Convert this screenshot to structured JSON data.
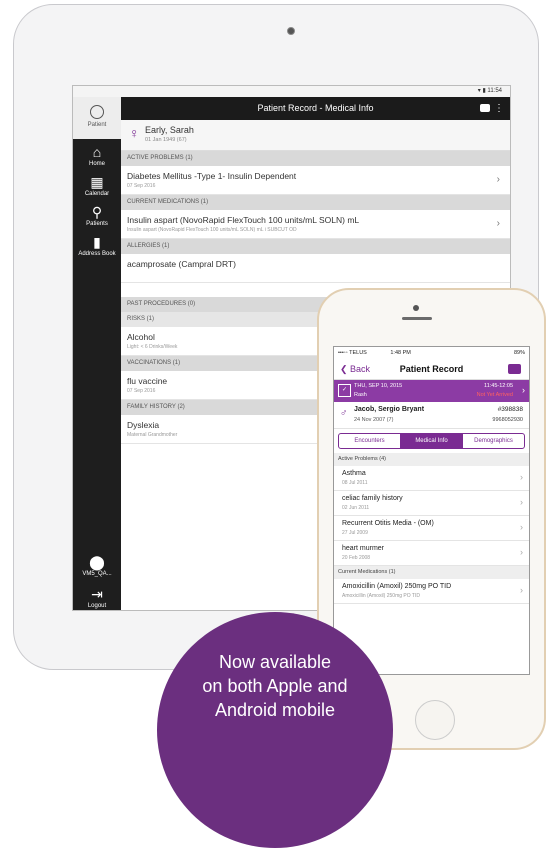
{
  "tablet": {
    "status_time": "11:54",
    "title": "Patient Record - Medical Info",
    "patient": {
      "name": "Early, Sarah",
      "dob": "01 Jan 1949 (67)"
    },
    "sidebar": [
      {
        "label": "Patient",
        "icon": "patient-icon"
      },
      {
        "label": "Home",
        "icon": "home-icon"
      },
      {
        "label": "Calendar",
        "icon": "calendar-icon"
      },
      {
        "label": "Patients",
        "icon": "search-icon"
      },
      {
        "label": "Address Book",
        "icon": "address-book-icon"
      },
      {
        "label": "VM5_QA...",
        "icon": "location-icon"
      },
      {
        "label": "Logout",
        "icon": "logout-icon"
      }
    ],
    "sections": [
      {
        "header": "ACTIVE PROBLEMS (1)",
        "title": "Diabetes Mellitus -Type 1- Insulin Dependent",
        "sub": "07 Sep 2016"
      },
      {
        "header": "CURRENT MEDICATIONS (1)",
        "title": "Insulin aspart (NovoRapid FlexTouch 100 units/mL SOLN) mL",
        "sub": "Insulin aspart (NovoRapid FlexTouch 100 units/mL SOLN) mL i SUBCUT OD"
      },
      {
        "header": "ALLERGIES (1)",
        "title": "acamprosate (Campral DRT)",
        "sub": ""
      },
      {
        "header": "PAST PROCEDURES (0)"
      },
      {
        "header": "RISKS (1)",
        "title": "Alcohol",
        "sub": "Light: < 6 Drinks/Week"
      },
      {
        "header": "VACCINATIONS (1)",
        "title": "flu vaccine",
        "sub": "07 Sep 2016"
      },
      {
        "header": "FAMILY HISTORY (2)",
        "title": "Dyslexia",
        "sub": "Maternal Grandmother"
      }
    ]
  },
  "phone": {
    "carrier": "•••◦◦ TELUS",
    "time": "1:48 PM",
    "battery": "89%",
    "back": "Back",
    "title": "Patient Record",
    "encounter": {
      "date": "THU, SEP 10, 2015",
      "reason": "Rash",
      "time": "11:45-12:05",
      "status": "Not Yet Arrived"
    },
    "patient": {
      "name": "Jacob, Sergio Bryant",
      "dob": "24 Nov 2007 (7)",
      "id": "#398838",
      "hc": "9968052930"
    },
    "tabs": [
      "Encounters",
      "Medical Info",
      "Demographics"
    ],
    "active_header": "Active Problems (4)",
    "problems": [
      {
        "title": "Asthma",
        "date": "08 Jul 2011"
      },
      {
        "title": "celiac family history",
        "date": "02 Jun 2011"
      },
      {
        "title": "Recurrent Otitis Media - (OM)",
        "date": "27 Jul 2009"
      },
      {
        "title": "heart murmer",
        "date": "20 Feb 2008"
      }
    ],
    "med_header": "Current Medications (1)",
    "medication": {
      "title": "Amoxicillin (Amoxil) 250mg  PO  TID",
      "sub": "Amoxicillin (Amoxil) 250mg  PO  TID"
    }
  },
  "promo": {
    "line1": "Now available",
    "line2": "on both Apple and",
    "line3": "Android mobile"
  }
}
